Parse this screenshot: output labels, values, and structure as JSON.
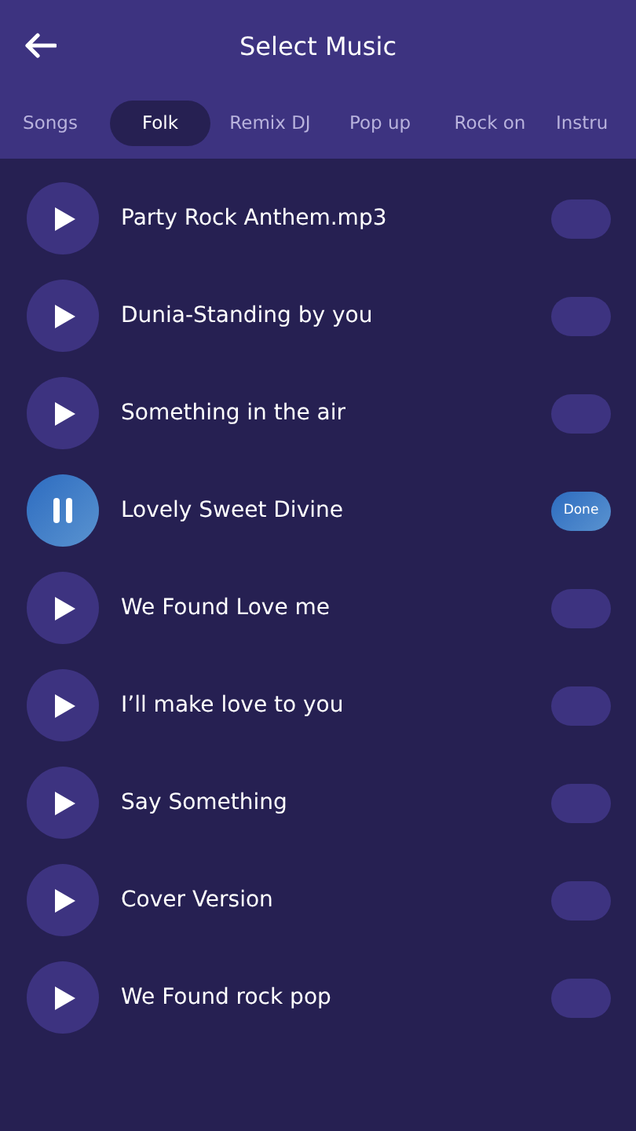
{
  "header": {
    "title": "Select Music"
  },
  "tabs": [
    {
      "label": "Songs",
      "selected": false
    },
    {
      "label": "Folk",
      "selected": true
    },
    {
      "label": "Remix DJ",
      "selected": false
    },
    {
      "label": "Pop up",
      "selected": false
    },
    {
      "label": "Rock on",
      "selected": false
    },
    {
      "label": "Instru",
      "selected": false
    }
  ],
  "songs": [
    {
      "title": "Party Rock Anthem.mp3",
      "playing": false
    },
    {
      "title": "Dunia-Standing by you",
      "playing": false
    },
    {
      "title": "Something in the air",
      "playing": false
    },
    {
      "title": "Lovely Sweet Divine",
      "playing": true,
      "button_label": "Done"
    },
    {
      "title": "We Found Love me",
      "playing": false
    },
    {
      "title": "I’ll make love to you",
      "playing": false
    },
    {
      "title": "Say Something",
      "playing": false
    },
    {
      "title": "Cover Version",
      "playing": false
    },
    {
      "title": "We Found rock pop",
      "playing": false
    }
  ]
}
